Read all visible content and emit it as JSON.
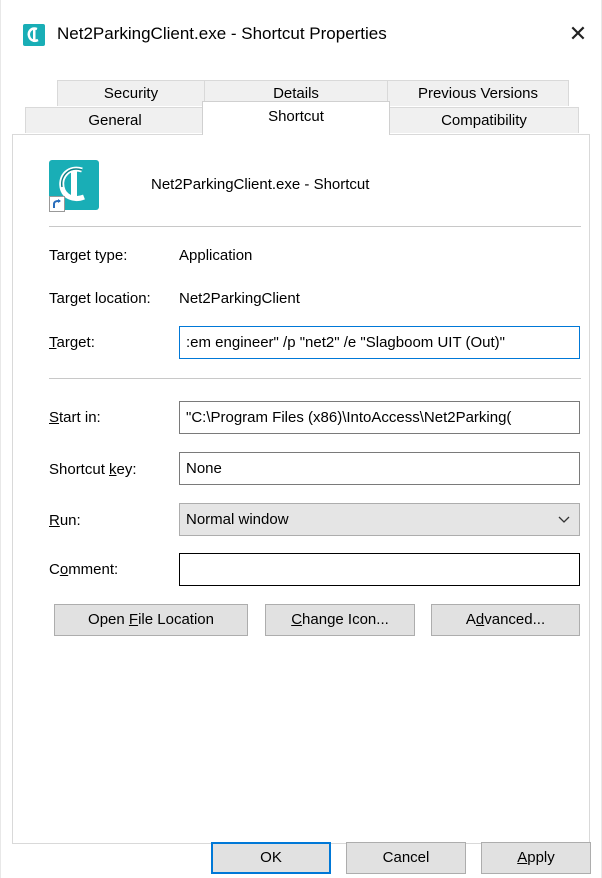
{
  "window": {
    "title": "Net2ParkingClient.exe - Shortcut Properties",
    "close_label": "✕"
  },
  "tabs": {
    "row1": [
      "Security",
      "Details",
      "Previous Versions"
    ],
    "row2": [
      "General",
      "Shortcut",
      "Compatibility"
    ],
    "active": "Shortcut"
  },
  "shortcut": {
    "name": "Net2ParkingClient.exe - Shortcut"
  },
  "fields": {
    "target_type_label": "Target type:",
    "target_type_value": "Application",
    "target_location_label": "Target location:",
    "target_location_value": "Net2ParkingClient",
    "target_label_first": "T",
    "target_label_rest": "arget:",
    "target_value": ":em engineer\" /p \"net2\" /e \"Slagboom UIT (Out)\"",
    "start_in_label_first": "S",
    "start_in_label_rest": "tart in:",
    "start_in_value": "\"C:\\Program Files (x86)\\IntoAccess\\Net2Parking(",
    "shortcut_key_label_pre": "Shortcut ",
    "shortcut_key_label_first": "k",
    "shortcut_key_label_rest": "ey:",
    "shortcut_key_value": "None",
    "run_label_first": "R",
    "run_label_rest": "un:",
    "run_value": "Normal window",
    "comment_label_pre": "C",
    "comment_label_first": "o",
    "comment_label_rest": "mment:",
    "comment_value": ""
  },
  "buttons": {
    "open_file_location_pre": "Open ",
    "open_file_location_first": "F",
    "open_file_location_rest": "ile Location",
    "change_icon_first": "C",
    "change_icon_rest": "hange Icon...",
    "advanced_pre": "A",
    "advanced_first": "d",
    "advanced_rest": "vanced...",
    "ok": "OK",
    "cancel": "Cancel",
    "apply_first": "A",
    "apply_rest": "pply"
  },
  "colors": {
    "accent": "#0078d7",
    "app_icon": "#19aeb6"
  }
}
